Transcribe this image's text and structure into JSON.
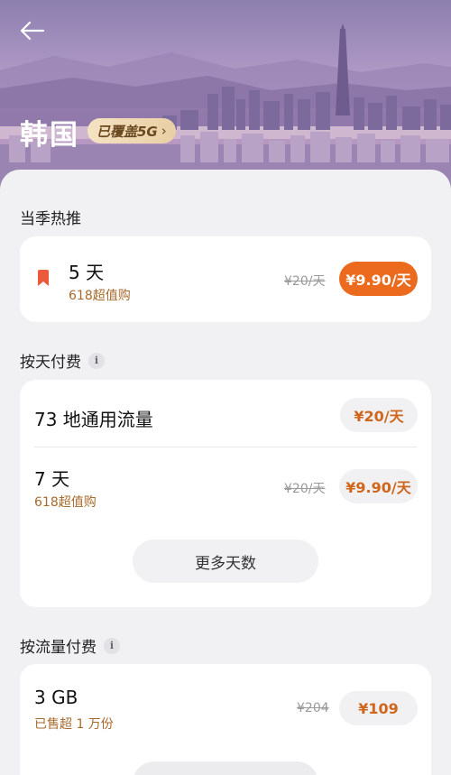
{
  "header": {
    "back_icon": "arrow-left-icon",
    "title": "韩国",
    "badge": "已覆盖5G",
    "badge_chevron": "›"
  },
  "colors": {
    "accent_orange": "#ec6a1d",
    "accent_text_orange": "#d0661c",
    "sub_text_brown": "#a86a2c",
    "badge_gold": "#f4e2c2"
  },
  "sections": {
    "seasonal": {
      "title": "当季热推",
      "item": {
        "icon": "bookmark-icon",
        "name": "5 天",
        "sub": "618超值购",
        "original_price": "¥20/天",
        "price": "¥9.90/天"
      }
    },
    "daily": {
      "title": "按天付费",
      "info_icon": "i",
      "items": [
        {
          "name": "73 地通用流量",
          "price": "¥20/天"
        },
        {
          "name": "7 天",
          "sub": "618超值购",
          "original_price": "¥20/天",
          "price": "¥9.90/天"
        }
      ],
      "more_label": "更多天数"
    },
    "traffic": {
      "title": "按流量付费",
      "info_icon": "i",
      "items": [
        {
          "name": "3 GB",
          "sub": "已售超 1 万份",
          "original_price": "¥204",
          "price": "¥109"
        }
      ]
    }
  }
}
